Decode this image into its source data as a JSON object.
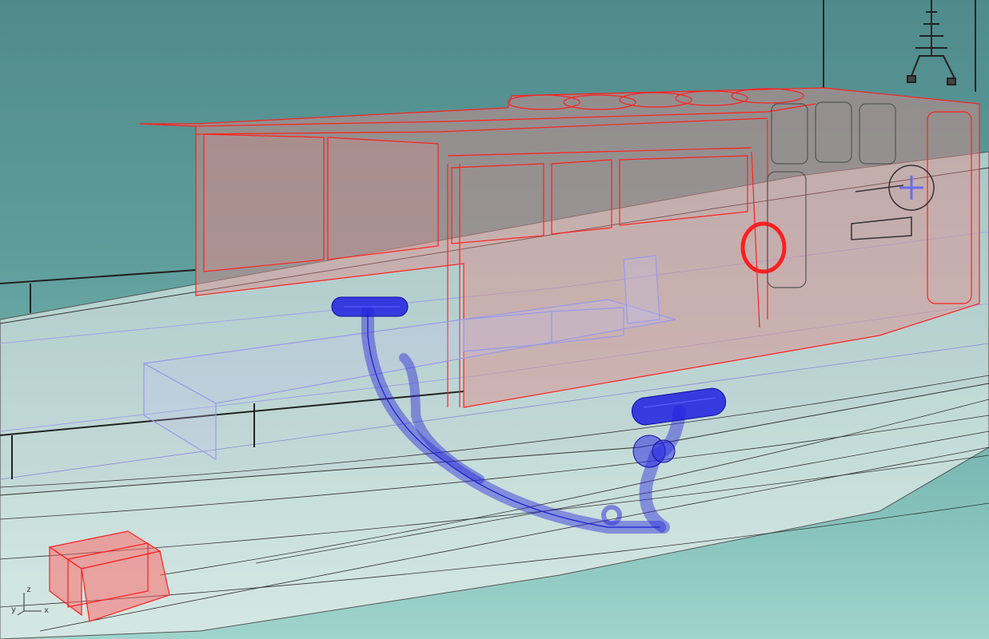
{
  "viewport": {
    "name": "perspective-3d-viewport",
    "axes": {
      "x": "x",
      "y": "y",
      "z": "z"
    }
  },
  "colors": {
    "background_top": "#4f8b8b",
    "background_bottom": "#9fd4cc",
    "hull": "#c9ddd9",
    "cabin_wire": "#ff2020",
    "cabin_fill": "#e8a0a0",
    "pipe": "#2a2ad8",
    "deck_wire": "#b0b0ff"
  }
}
